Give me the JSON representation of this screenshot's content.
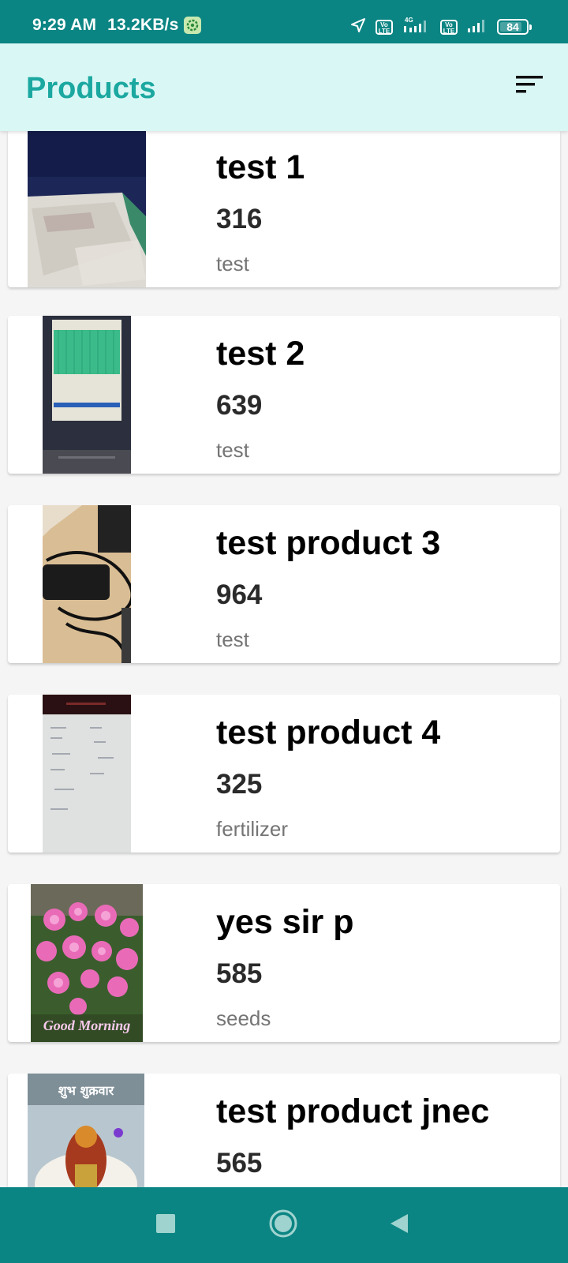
{
  "status_bar": {
    "time": "9:29 AM",
    "net_speed": "13.2KB/s",
    "network_type": "4G",
    "battery": "84",
    "battery_level": 0.84,
    "color": "#0b8583"
  },
  "app_bar": {
    "title": "Products",
    "background": "#d9f7f5",
    "title_color": "#1ba8a0",
    "action_icon": "sort-icon"
  },
  "products": [
    {
      "name": "test 1",
      "price": "316",
      "category": "test"
    },
    {
      "name": "test 2",
      "price": "639",
      "category": "test"
    },
    {
      "name": "test product 3",
      "price": "964",
      "category": "test"
    },
    {
      "name": "test product 4",
      "price": "325",
      "category": "fertilizer"
    },
    {
      "name": "yes sir p",
      "price": "585",
      "category": "seeds",
      "image_text": "Good Morning"
    },
    {
      "name": "test product jnec",
      "price": "565",
      "category": "",
      "image_text": "शुभ शुक्रवार"
    }
  ],
  "nav_bar": {
    "buttons": [
      "recents-icon",
      "home-icon",
      "back-icon"
    ]
  }
}
